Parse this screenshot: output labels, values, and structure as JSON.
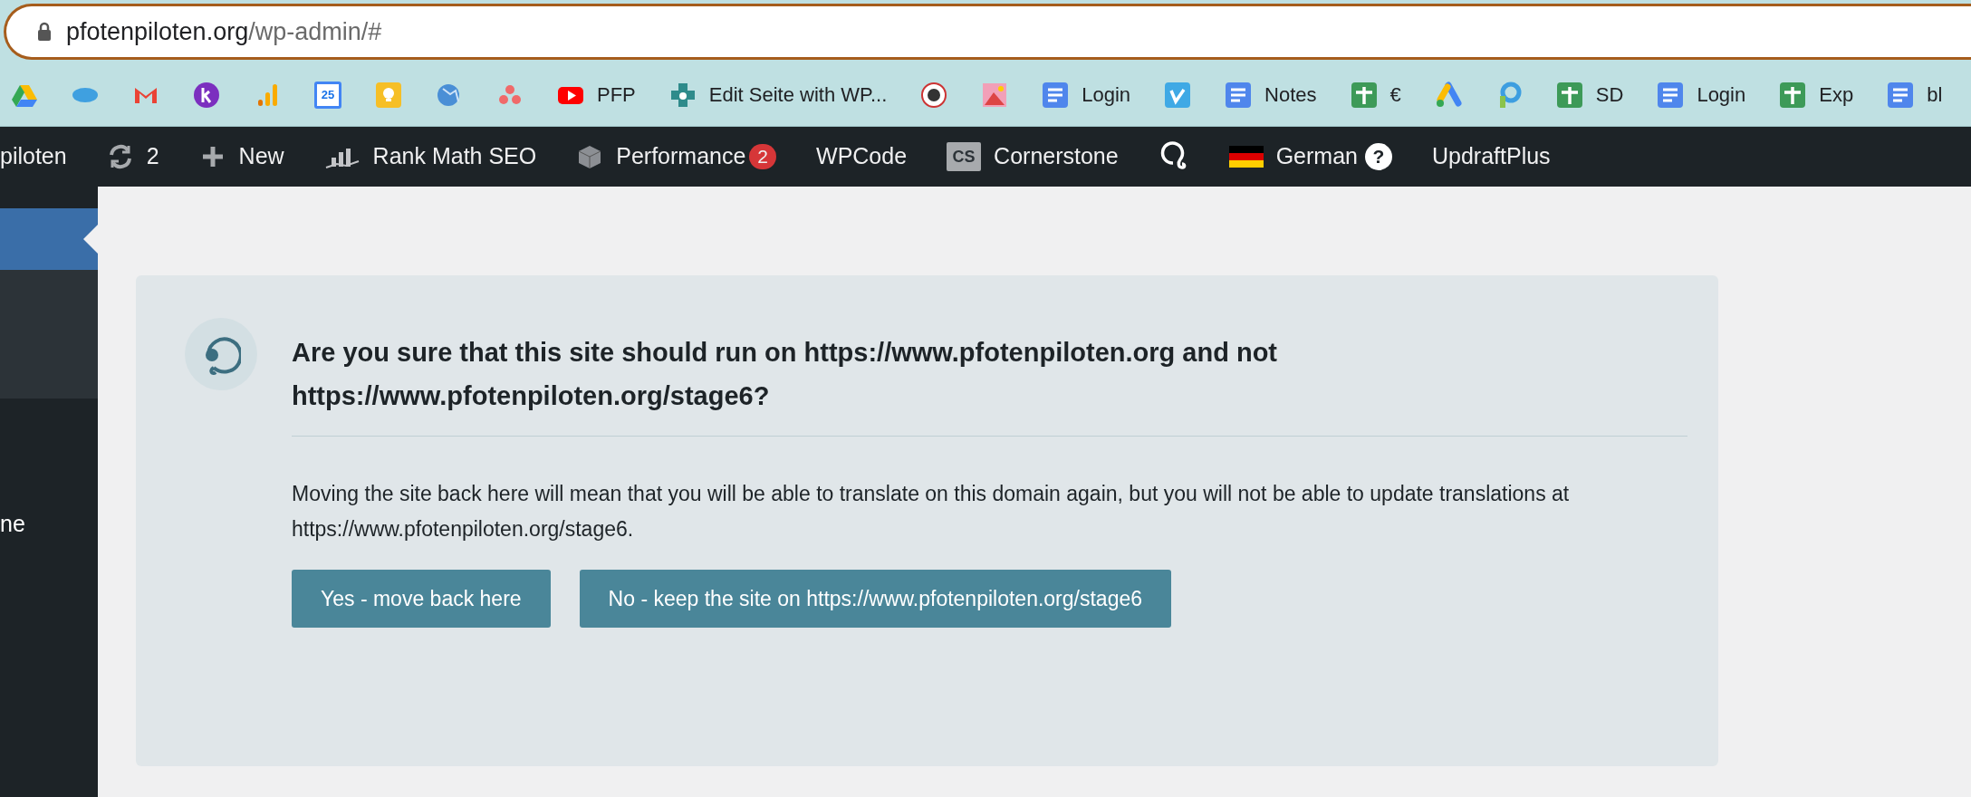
{
  "address_bar": {
    "domain": "pfotenpiloten.org",
    "path": "/wp-admin/#"
  },
  "bookmarks": [
    {
      "icon_text": "25"
    },
    {
      "label": "PFP"
    },
    {
      "label": "Edit Seite with WP..."
    },
    {
      "label": "Login"
    },
    {
      "label": "Notes"
    },
    {
      "label": "€"
    },
    {
      "label": "SD"
    },
    {
      "label": "Login"
    },
    {
      "label": "Exp"
    },
    {
      "label": "bl"
    }
  ],
  "admin_bar": [
    {
      "label": "piloten"
    },
    {
      "label": "2"
    },
    {
      "label": "New"
    },
    {
      "label": "Rank Math SEO"
    },
    {
      "label": "Performance",
      "badge": "2"
    },
    {
      "label": "WPCode"
    },
    {
      "icon_text": "CS",
      "label": "Cornerstone"
    },
    {
      "label": "German",
      "help": "?"
    },
    {
      "label": "UpdraftPlus"
    }
  ],
  "sidebar": {
    "items": [
      {
        "selected": true,
        "kind": "active"
      },
      {
        "selected": false,
        "kind": "submenu"
      },
      {
        "label": "ne",
        "selected": false,
        "kind": "item"
      }
    ]
  },
  "notice": {
    "title": "Are you sure that this site should run on https://www.pfotenpiloten.org and not https://www.pfotenpiloten.org/stage6?",
    "message": "Moving the site back here will mean that you will be able to translate on this domain again, but you will not be able to update translations at https://www.pfotenpiloten.org/stage6.",
    "buttons": [
      "Yes - move back here",
      "No - keep the site on https://www.pfotenpiloten.org/stage6"
    ]
  }
}
